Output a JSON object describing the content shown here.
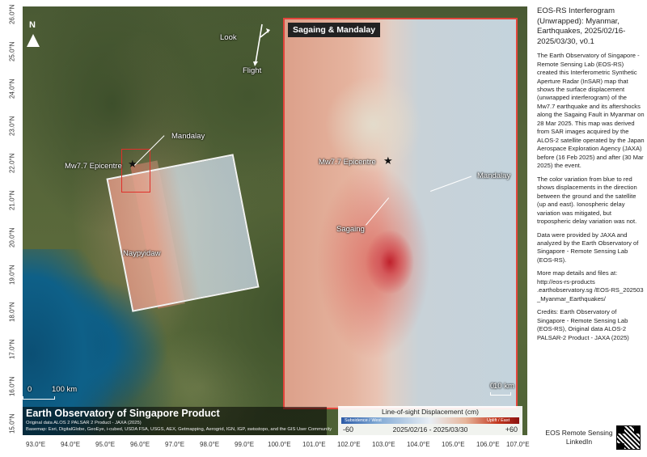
{
  "side_panel": {
    "title": "EOS-RS Interferogram (Unwrapped): Myanmar, Earthquakes, 2025/02/16-2025/03/30, v0.1",
    "paragraphs": [
      "The Earth Observatory of Singapore - Remote Sensing Lab (EOS-RS) created this Interferometric Synthetic Aperture Radar (InSAR) map that shows the surface displacement (unwrapped interferogram) of the Mw7.7 earthquake and its aftershocks along the Sagaing Fault in Myanmar on 28 Mar 2025. This map was derived from SAR images acquired by the ALOS-2 satellite operated by the Japan Aerospace Exploration Agency (JAXA) before (16 Feb 2025) and after (30 Mar 2025) the event.",
      "The color variation from blue to red shows displacements in the direction between the ground and the satellite (up and east). Ionospheric delay variation was mitigated, but tropospheric delay variation was not.",
      "Data were provided by JAXA and analyzed by the Earth Observatory of Singapore - Remote Sensing Lab (EOS-RS).",
      "More map details and files at: http://eos-rs-products .earthobservatory.sg /EOS-RS_202503 _Myanmar_Earthquakes/",
      "Credits: Earth Observatory of Singapore - Remote Sensing Lab (EOS-RS), Original data ALOS-2 PALSAR-2 Product - JAXA (2025)"
    ],
    "footer": "EOS Remote Sensing LinkedIn"
  },
  "main_map": {
    "north": "N",
    "look": "Look",
    "flight": "Flight",
    "mandalay": "Mandalay",
    "epicentre": "Mw7.7 Epicentre",
    "naypyidaw": "Naypyidaw",
    "scale_zero": "0",
    "scale_label": "100 km"
  },
  "inset_map": {
    "title": "Sagaing & Mandalay",
    "epicentre": "Mw7.7 Epicentre",
    "mandalay": "Mandalay",
    "sagaing": "Sagaing",
    "scale_zero": "0",
    "scale_label": "10 km"
  },
  "legend": {
    "title": "Line-of-sight Displacement (cm)",
    "left_label": "Subsidence / West",
    "right_label": "Uplift / East",
    "min": "-60",
    "max": "+60",
    "dates": "2025/02/16 - 2025/03/30"
  },
  "banner": {
    "title": "Earth Observatory of Singapore Product",
    "line1": "Original data ALOS 2 PALSAR 2 Product - JAXA (2025)",
    "line2": "Basemap: Esri, DigitalGlobe, GeoEye, i-cubed, USDA FSA, USGS, AEX, Getmapping, Aerogrid, IGN, IGP, swisstopo, and the GIS User Community"
  },
  "axes": {
    "latitudes": [
      "26.0°N",
      "25.0°N",
      "24.0°N",
      "23.0°N",
      "22.0°N",
      "21.0°N",
      "20.0°N",
      "19.0°N",
      "18.0°N",
      "17.0°N",
      "16.0°N",
      "15.0°N"
    ],
    "longitudes": [
      "93.0°E",
      "94.0°E",
      "95.0°E",
      "96.0°E",
      "97.0°E",
      "98.0°E",
      "99.0°E",
      "100.0°E",
      "101.0°E",
      "102.0°E",
      "103.0°E",
      "104.0°E",
      "105.0°E",
      "106.0°E",
      "107.0°E"
    ]
  },
  "colors": {
    "inset_border": "#e2453c",
    "ramp_blue": "#2b5aa6",
    "ramp_red": "#8c1210"
  }
}
